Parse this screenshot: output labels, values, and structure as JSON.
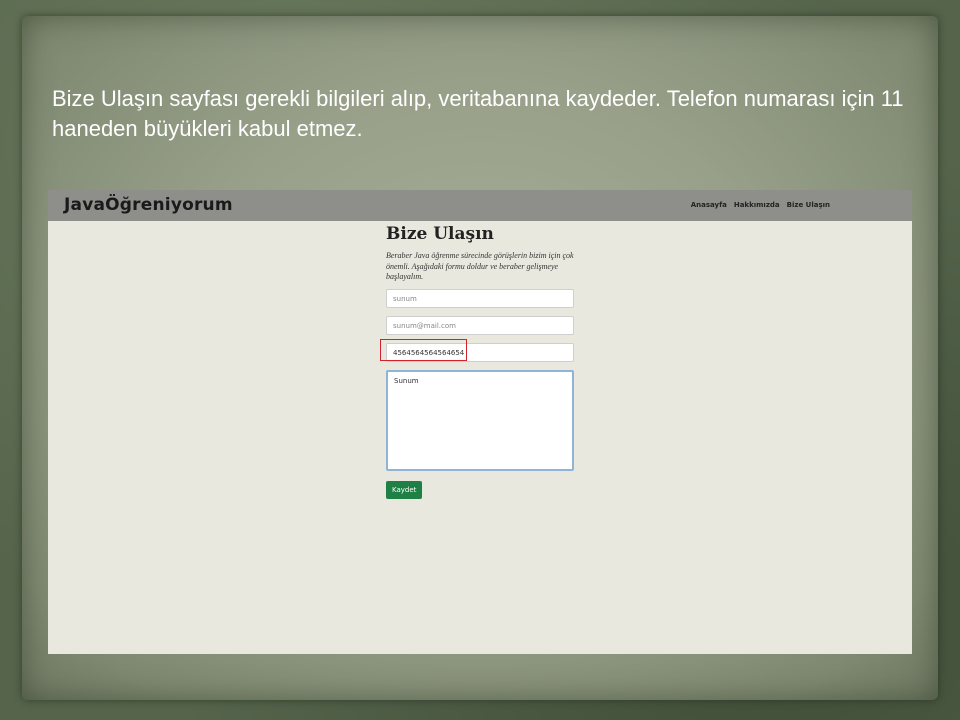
{
  "caption": "Bize Ulaşın sayfası gerekli bilgileri alıp, veritabanına kaydeder. Telefon numarası için 11 haneden büyükleri kabul etmez.",
  "site": {
    "brand": "JavaÖğreniyorum",
    "nav": [
      "Anasayfa",
      "Hakkımızda",
      "Bize Ulaşın"
    ]
  },
  "form": {
    "title": "Bize Ulaşın",
    "description": "Beraber Java öğrenme sürecinde görüşlerin bizim için çok önemli. Aşağıdaki formu doldur ve beraber gelişmeye başlayalım.",
    "name_value": "sunum",
    "email_value": "sunum@mail.com",
    "phone_value": "4564564564564654",
    "message_value": "Sunum",
    "submit_label": "Kaydet"
  },
  "colors": {
    "highlight": "#d0232a",
    "submit": "#1e8045",
    "navbar": "#8e8e8a"
  }
}
